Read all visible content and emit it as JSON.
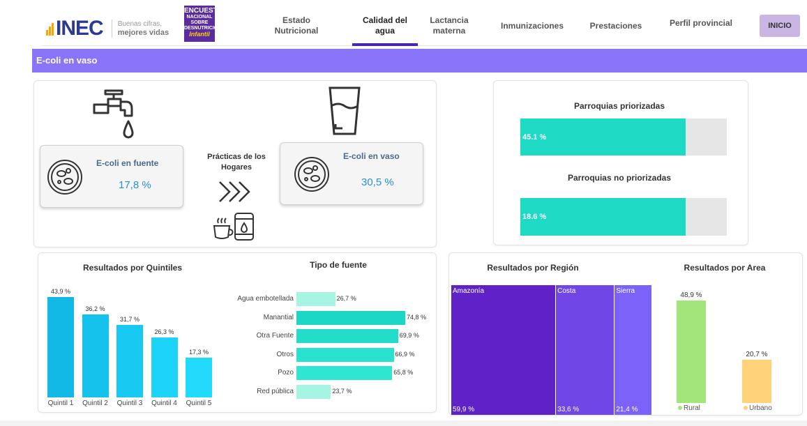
{
  "brand": {
    "logo": "INEC",
    "tagline_1": "Buenas cifras,",
    "tagline_2": "mejores vidas",
    "encuesta_1": "ENCUESTA",
    "encuesta_2": "NACIONAL SOBRE",
    "encuesta_3": "DESNUTRICIÓN",
    "encuesta_4": "Infantil"
  },
  "nav": [
    {
      "label_1": "Estado",
      "label_2": "Nutricional"
    },
    {
      "label_1": "Calidad del agua",
      "label_2": ""
    },
    {
      "label_1": "Lactancia",
      "label_2": "materna"
    },
    {
      "label_1": "Inmunizaciones",
      "label_2": ""
    },
    {
      "label_1": "Prestaciones",
      "label_2": ""
    },
    {
      "label_1": "Perfil provincial",
      "label_2": ""
    }
  ],
  "inicio": "INICIO",
  "page_title": "E-coli en vaso",
  "practices": {
    "fuente_title": "E-coli en fuente",
    "fuente_value": "17,8 %",
    "center_1": "Prácticas de los",
    "center_2": "Hogares",
    "vaso_title": "E-coli en vaso",
    "vaso_value": "30,5 %"
  },
  "parroquias": {
    "priorizadas_title": "Parroquias priorizadas",
    "priorizadas_value": "45.1 %",
    "priorizadas_fill": 0.8,
    "no_priorizadas_title": "Parroquias no priorizadas",
    "no_priorizadas_value": "18.6 %",
    "no_priorizadas_fill": 0.8
  },
  "colors": {
    "accent": "#8a74f7",
    "teal": "#1ed9c4",
    "nav_active": "#4c22b4"
  },
  "chart_data": [
    {
      "type": "bar",
      "title": "Resultados por Quintiles",
      "categories": [
        "Quintil 1",
        "Quintil 2",
        "Quintil 3",
        "Quintil 4",
        "Quintil 5"
      ],
      "values": [
        43.9,
        36.2,
        31.7,
        26.3,
        17.3
      ],
      "labels": [
        "43,9 %",
        "36,2 %",
        "31,7 %",
        "26,3 %",
        "17,3 %"
      ],
      "colors": [
        "#12b9e6",
        "#14c2ec",
        "#18caf2",
        "#1dd3f7",
        "#22dbfc"
      ]
    },
    {
      "type": "bar",
      "orientation": "horizontal",
      "title": "Tipo de fuente",
      "categories": [
        "Agua embotellada",
        "Manantial",
        "Otra Fuente",
        "Otros",
        "Pozo",
        "Red pública"
      ],
      "values": [
        26.7,
        74.8,
        69.9,
        66.9,
        65.8,
        23.7
      ],
      "labels": [
        "26,7 %",
        "74,8 %",
        "69,9 %",
        "66,9 %",
        "65,8 %",
        "23,7 %"
      ],
      "colors": [
        "#a6f5e3",
        "#1ad8c4",
        "#22dec9",
        "#28e2cd",
        "#2ee6d1",
        "#a6f5e3"
      ]
    },
    {
      "type": "treemap",
      "title": "Resultados por Región",
      "categories": [
        "Amazonía",
        "Costa",
        "Sierra"
      ],
      "values": [
        59.9,
        33.6,
        21.4
      ],
      "labels": [
        "59,9 %",
        "33,6 %",
        "21,4 %"
      ],
      "colors": [
        "#5e22c7",
        "#7047e6",
        "#7d62fa"
      ]
    },
    {
      "type": "bar",
      "title": "Resultados por Area",
      "categories": [
        "Rural",
        "Urbano"
      ],
      "values": [
        48.9,
        20.7
      ],
      "labels": [
        "48,9 %",
        "20,7 %"
      ],
      "colors": [
        "#a3e57a",
        "#ffd27a"
      ]
    }
  ]
}
